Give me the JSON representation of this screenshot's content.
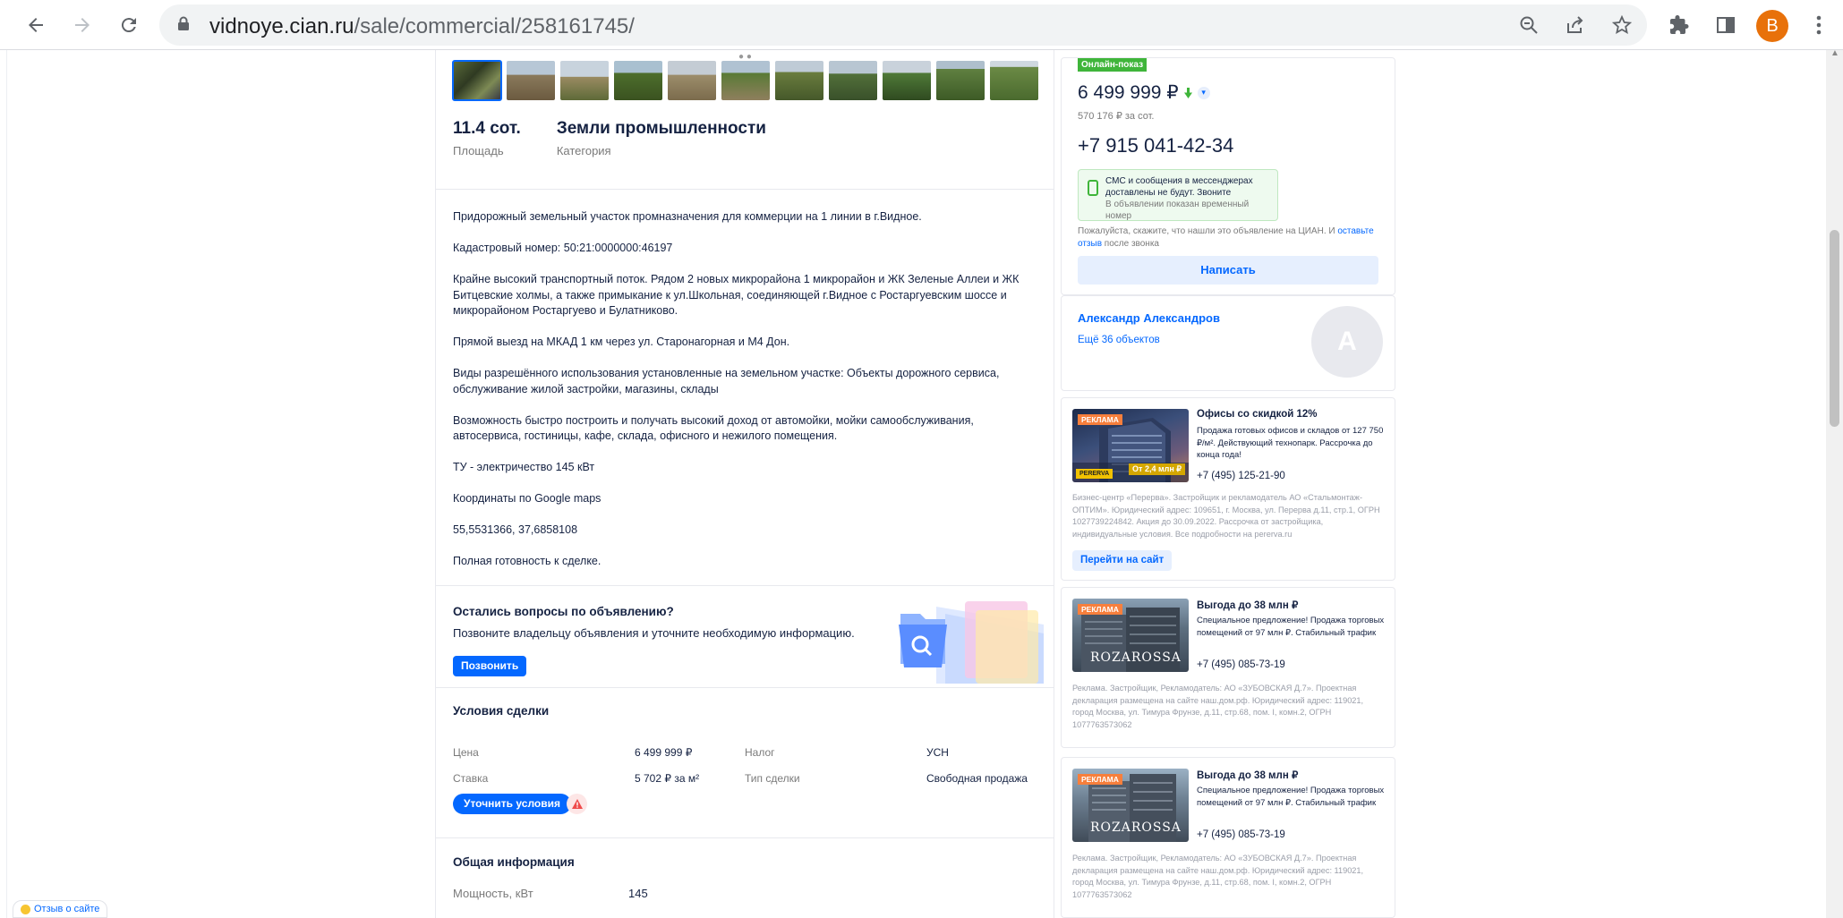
{
  "browser": {
    "url_host": "vidnoye.cian.ru",
    "url_path": "/sale/commercial/258161745/",
    "profile_initial": "B",
    "icons": [
      "back-arrow-icon",
      "forward-arrow-icon",
      "reload-icon",
      "lock-icon",
      "zoom-out-icon",
      "share-icon",
      "star-icon",
      "extensions-icon",
      "side-panel-icon",
      "kebab-menu-icon"
    ]
  },
  "listing": {
    "facts": [
      {
        "value": "11.4 сот.",
        "label": "Площадь"
      },
      {
        "value": "Земли промышленности",
        "label": "Категория"
      }
    ],
    "description": [
      "Придорожный земельный участок промназначения для коммерции на 1 линии в г.Видное.",
      "Кадастровый номер: 50:21:0000000:46197",
      "Крайне высокий транспортный поток. Рядом 2 новых микрорайона 1 микрорайон и ЖК Зеленые Аллеи и ЖК Битцевские холмы, а также примыкание к ул.Школьная, соединяющей г.Видное с Ростаргуевским шоссе и микрорайоном Ростаргуево и Булатниково.",
      "Прямой выезд на МКАД 1 км через ул. Старонагорная и М4 Дон.",
      "Виды разрешённого использования установленные на земельном участке: Объекты дорожного сервиса, обслуживание жилой застройки, магазины, склады",
      "Возможность быстро построить и получать высокий доход от автомойки, мойки самообслуживания, автосервиса, гостиницы, кафе, склада, офисного и нежилого помещения.",
      "ТУ - электричество 145 кВт",
      "Координаты по Google maps",
      "55,5531366, 37,6858108",
      "Полная готовность к сделке."
    ],
    "questions": {
      "title": "Остались вопросы по объявлению?",
      "text": "Позвоните владельцу объявления и уточните необходимую информацию.",
      "button": "Позвонить"
    },
    "deal": {
      "title": "Условия сделки",
      "rows": [
        {
          "label": "Цена",
          "value": "6 499 999 ₽",
          "label2": "Налог",
          "value2": "УСН"
        },
        {
          "label": "Ставка",
          "value": "5 702 ₽ за м²",
          "label2": "Тип сделки",
          "value2": "Свободная продажа"
        }
      ],
      "button": "Уточнить условия"
    },
    "general": {
      "title": "Общая информация",
      "label": "Мощность, кВт",
      "value": "145"
    }
  },
  "sidebar": {
    "badge": "Онлайн-показ",
    "price": "6 499 999 ₽",
    "price_per": "570 176 ₽ за сот.",
    "phone": "+7 915 041-42-34",
    "sms_notice": "СМС и сообщения в мессенджерах доставлены не будут. Звоните",
    "sms_sub": "В объявлении показан временный номер",
    "feedback_before": "Пожалуйста, скажите, что нашли это объявление на ЦИАН. И ",
    "feedback_link": "оставьте отзыв",
    "feedback_after": " после звонка",
    "write_button": "Написать",
    "agent_name": "Александр Александров",
    "agent_more": "Ещё 36 объектов",
    "agent_initial": "А"
  },
  "ads": [
    {
      "tag": "РЕКЛАМА",
      "title": "Офисы со скидкой 12%",
      "text": "Продажа готовых офисов и складов от 127 750 ₽/м². Действующий технопарк. Рассрочка до конца года!",
      "phone": "+7 (495) 125-21-90",
      "legal": "Бизнес-центр «Перерва». Застройщик и рекламодатель АО «Стальмонтаж-ОПТИМ». Юридический адрес: 109651, г. Москва, ул. Перерва д.11, стр.1, ОГРН 1027739224842. Акция до 30.09.2022. Рассрочка от застройщика, индивидуальные условия. Все подробности на pererva.ru",
      "button": "Перейти на сайт",
      "img_brand": "PERERVA",
      "img_price": "От 2,4 млн ₽"
    },
    {
      "tag": "РЕКЛАМА",
      "title": "Выгода до 38 млн ₽",
      "text": "Специальное предложение! Продажа торговых помещений от 97 млн ₽. Стабильный трафик",
      "phone": "+7 (495) 085-73-19",
      "legal": "Реклама. Застройщик, Рекламодатель: АО «ЗУБОВСКАЯ Д.7». Проектная декларация размещена на сайте наш.дом.рф. Юридический адрес: 119021, город Москва, ул. Тимура Фрунзе, д.11, стр.68, пом. I, комн.2, ОГРН 1077763573062",
      "img_brand": "ROZAROSSA"
    },
    {
      "tag": "РЕКЛАМА",
      "title": "Выгода до 38 млн ₽",
      "text": "Специальное предложение! Продажа торговых помещений от 97 млн ₽. Стабильный трафик",
      "phone": "+7 (495) 085-73-19",
      "legal": "Реклама. Застройщик, Рекламодатель: АО «ЗУБОВСКАЯ Д.7». Проектная декларация размещена на сайте наш.дом.рф. Юридический адрес: 119021, город Москва, ул. Тимура Фрунзе, д.11, стр.68, пом. I, комн.2, ОГРН 1077763573062",
      "img_brand": "ROZAROSSA"
    }
  ],
  "site_feedback": "Отзыв о сайте",
  "colors": {
    "accent": "#0468ff",
    "green": "#3fb53a",
    "ad_tag": "#f77f3c",
    "text": "#152242",
    "muted": "#7a7a7a"
  }
}
